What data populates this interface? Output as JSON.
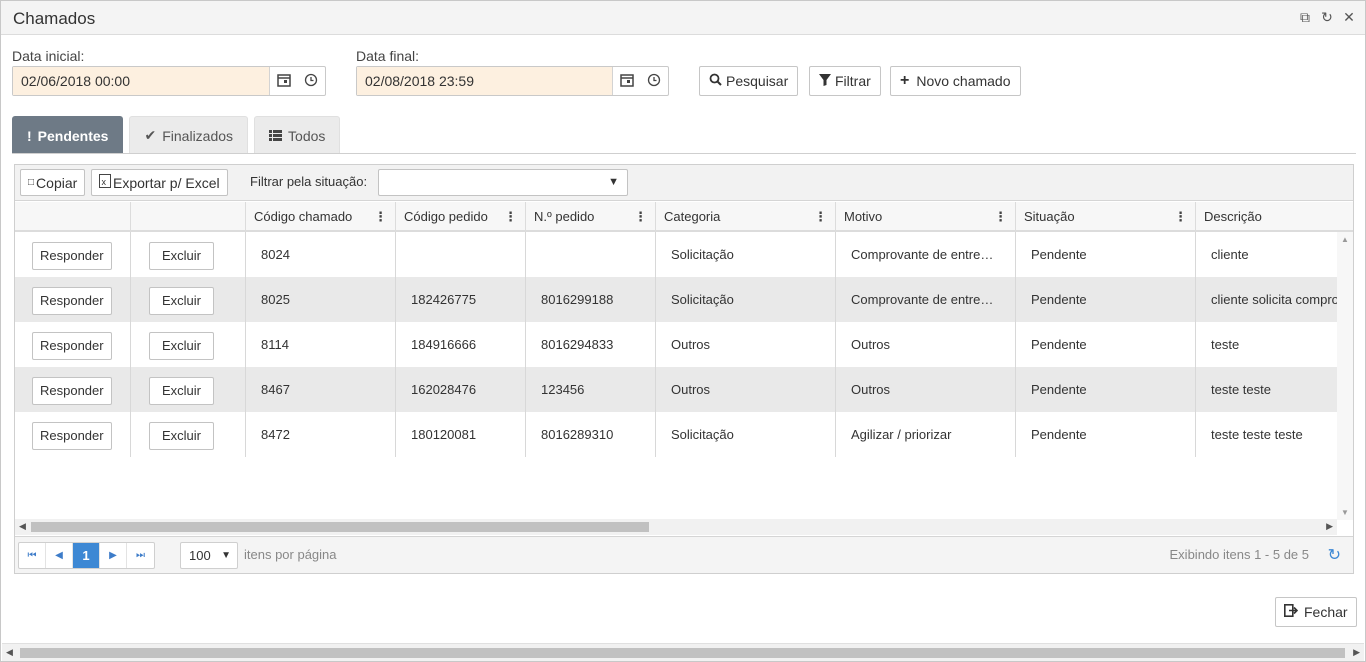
{
  "window": {
    "title": "Chamados"
  },
  "filters": {
    "start_label": "Data inicial:",
    "start_value": "02/06/2018 00:00",
    "end_label": "Data final:",
    "end_value": "02/08/2018 23:59"
  },
  "actions": {
    "search": "Pesquisar",
    "filter": "Filtrar",
    "new_ticket": "Novo chamado"
  },
  "tabs": [
    {
      "label": "Pendentes",
      "icon": "exclamation-icon",
      "active": true
    },
    {
      "label": "Finalizados",
      "icon": "check-icon",
      "active": false
    },
    {
      "label": "Todos",
      "icon": "list-icon",
      "active": false
    }
  ],
  "grid_toolbar": {
    "copy": "Copiar",
    "export": "Exportar p/ Excel",
    "filter_label": "Filtrar pela situação:",
    "filter_value": ""
  },
  "columns": [
    "Código chamado",
    "Código pedido",
    "N.º pedido",
    "Categoria",
    "Motivo",
    "Situação",
    "Descrição"
  ],
  "row_buttons": {
    "reply": "Responder",
    "delete": "Excluir"
  },
  "rows": [
    {
      "codigo_chamado": "8024",
      "codigo_pedido": "",
      "numero_pedido": "",
      "categoria": "Solicitação",
      "motivo": "Comprovante de entre…",
      "situacao": "Pendente",
      "descricao": "cliente"
    },
    {
      "codigo_chamado": "8025",
      "codigo_pedido": "182426775",
      "numero_pedido": "8016299188",
      "categoria": "Solicitação",
      "motivo": "Comprovante de entre…",
      "situacao": "Pendente",
      "descricao": "cliente solicita compro"
    },
    {
      "codigo_chamado": "8114",
      "codigo_pedido": "184916666",
      "numero_pedido": "8016294833",
      "categoria": "Outros",
      "motivo": "Outros",
      "situacao": "Pendente",
      "descricao": "teste"
    },
    {
      "codigo_chamado": "8467",
      "codigo_pedido": "162028476",
      "numero_pedido": "123456",
      "categoria": "Outros",
      "motivo": "Outros",
      "situacao": "Pendente",
      "descricao": "teste teste"
    },
    {
      "codigo_chamado": "8472",
      "codigo_pedido": "180120081",
      "numero_pedido": "8016289310",
      "categoria": "Solicitação",
      "motivo": "Agilizar / priorizar",
      "situacao": "Pendente",
      "descricao": "teste teste teste"
    }
  ],
  "pager": {
    "current_page": "1",
    "page_size": "100",
    "page_size_label": "itens por página",
    "info": "Exibindo itens 1 - 5 de 5"
  },
  "footer": {
    "close": "Fechar"
  },
  "colors": {
    "accent": "#3d88d4",
    "active_tab": "#6e7a86",
    "date_bg": "#fdf0e0",
    "row_alt": "#e9e9e9"
  }
}
